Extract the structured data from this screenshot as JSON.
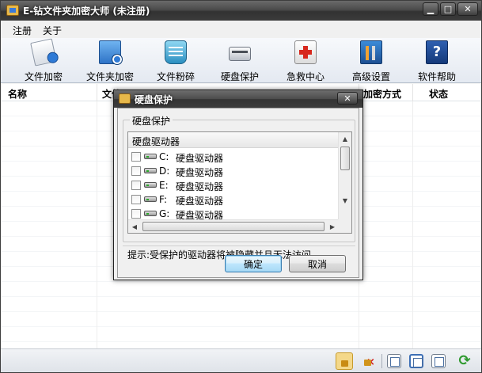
{
  "window": {
    "title": "E-钻文件夹加密大师 (未注册)",
    "min_label": "▁",
    "max_label": "□",
    "close_label": "✕"
  },
  "menu": {
    "items": [
      "注册",
      "关于"
    ]
  },
  "toolbar": {
    "items": [
      {
        "label": "文件加密",
        "icon": "file-lock-icon"
      },
      {
        "label": "文件夹加密",
        "icon": "folder-lock-icon"
      },
      {
        "label": "文件粉碎",
        "icon": "shredder-icon"
      },
      {
        "label": "硬盘保护",
        "icon": "hard-drive-icon"
      },
      {
        "label": "急救中心",
        "icon": "first-aid-icon"
      },
      {
        "label": "高级设置",
        "icon": "tools-icon"
      },
      {
        "label": "软件帮助",
        "icon": "help-book-icon"
      }
    ],
    "help_glyph": "?"
  },
  "list": {
    "columns": [
      "名称",
      "文件",
      "加密方式",
      "状态"
    ]
  },
  "statusbar": {
    "refresh_glyph": "⟳"
  },
  "dialog": {
    "title": "硬盘保护",
    "close_label": "✕",
    "group_label": "硬盘保护",
    "list_header": "硬盘驱动器",
    "drives": [
      {
        "letter": "C:",
        "name": "硬盘驱动器",
        "checked": false
      },
      {
        "letter": "D:",
        "name": "硬盘驱动器",
        "checked": false
      },
      {
        "letter": "E:",
        "name": "硬盘驱动器",
        "checked": false
      },
      {
        "letter": "F:",
        "name": "硬盘驱动器",
        "checked": false
      },
      {
        "letter": "G:",
        "name": "硬盘驱动器",
        "checked": false
      }
    ],
    "scroll_up": "▲",
    "scroll_down": "▼",
    "scroll_left": "◀",
    "scroll_right": "▶",
    "hint": "提示:受保护的驱动器将被隐藏并且无法访问",
    "ok_label": "确定",
    "cancel_label": "取消"
  }
}
